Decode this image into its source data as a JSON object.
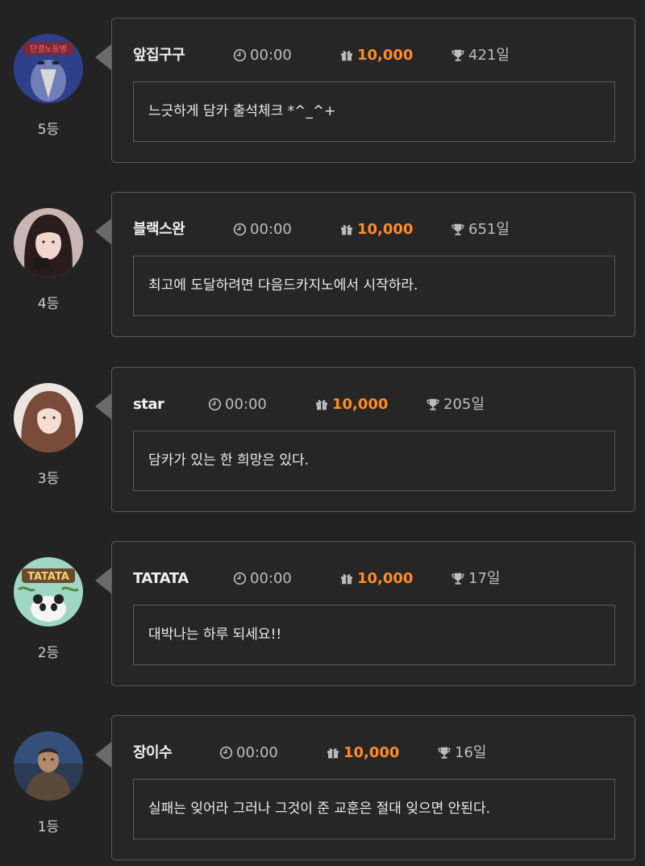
{
  "entries": [
    {
      "rank": "5등",
      "name": "앞집구구",
      "time": "00:00",
      "points": "10,000",
      "days": "421일",
      "message": "느긋하게 담카 출석체크 *^_^+",
      "avatar_badge": "단결노동병"
    },
    {
      "rank": "4등",
      "name": "블랙스완",
      "time": "00:00",
      "points": "10,000",
      "days": "651일",
      "message": "최고에 도달하려면 다음드카지노에서 시작하라."
    },
    {
      "rank": "3등",
      "name": "star",
      "time": "00:00",
      "points": "10,000",
      "days": "205일",
      "message": "담카가 있는 한 희망은 있다."
    },
    {
      "rank": "2등",
      "name": "TATATA",
      "time": "00:00",
      "points": "10,000",
      "days": "17일",
      "message": "대박나는 하루 되세요!!",
      "avatar_badge": "TATATA"
    },
    {
      "rank": "1등",
      "name": "장이수",
      "time": "00:00",
      "points": "10,000",
      "days": "16일",
      "message": "실패는 잊어라 그러나 그것이 준 교훈은 절대 잊으면 안된다."
    }
  ],
  "icons": {
    "time": "clock-icon",
    "points": "gift-icon",
    "days": "trophy-icon"
  },
  "colors": {
    "background": "#232323",
    "card_border": "#5a5a5a",
    "points": "#ff8a2a",
    "text": "#e6e6e6"
  }
}
